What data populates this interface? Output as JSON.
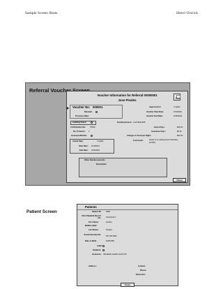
{
  "header": {
    "left": "Sample Screen Shots",
    "right": "Sherri Orwick"
  },
  "referral": {
    "section_title": "Referral Voucher Screen",
    "window_title": "Voucher Information for Referral 00000001",
    "patient_name": "Jose Pinales",
    "voucher_no_label": "Voucher No:",
    "voucher_no": "000001",
    "renewal_label": "Renewal",
    "provision_date_label": "Provision Date:",
    "approved_for_label": "Approved for",
    "approved_for_value": "3 nights",
    "voucher_start_label": "Voucher Start Date:",
    "voucher_start": "2/11/2004",
    "voucher_end_label": "Voucher End Date:",
    "voucher_end": "2/15/2004",
    "funding_label": "Funding Source:",
    "funding_value": "4-0278/9/2256",
    "auditing_label": "Auditing Faxed",
    "confirmation_label": "Confirmation No:",
    "confirmation_value": "79400",
    "num_guests_label": "No of Guests:",
    "num_guests_value": "1",
    "insurance_label": "Insurance/Rental:",
    "guest_pays_label": "Guest Pays:",
    "guest_pays_value": "$20.00",
    "insurance_pays_label": "Insurance Pays:",
    "insurance_pays_value": "$0.00",
    "charges_label": "Charges to Fund per Night:",
    "charges_value": "$20.00",
    "actual_stay_label": "Actual Stay:",
    "actual_stay_value": "3 nights",
    "start_date_label": "Start Date:",
    "start_date": "2/11/2004",
    "end_date_label": "End Date:",
    "end_date": "2/15/2004",
    "comments_label": "Comments:",
    "comments_value": "Guest is on waiting list for Monday, 2/16/04",
    "other_label": "Other Reimbursements",
    "description_label": "Description",
    "close_label": "Close"
  },
  "patients": {
    "section_title": "Patient Screen",
    "window_title": "Patients",
    "patient_id_label": "Patient ID:",
    "patient_id_value": "0000",
    "ucla_label": "UCLA Medical Record No:",
    "ucla_value": "124-00-04-7",
    "first_name_label": "First Name:",
    "first_name_value": "Andrea",
    "middle_initial_label": "Middle initial:",
    "last_name_label": "Last Name:",
    "last_name_value": "Pinales",
    "ssn_label": "Social Security No:",
    "ssn_value": "567-38-7890",
    "dob_label": "Date of Birth:",
    "dob_value": "6/25/1984",
    "adult_label": "Adult:",
    "pediatric_label": "Pediatric:",
    "insurance_label": "Insurance:",
    "insurance_value": "Affordable Health Care/CCS",
    "address_label": "Address:",
    "contact_label": "Contact:",
    "phone_label": "Phone:",
    "extension_label": "Extension:",
    "close_label": "Close"
  }
}
